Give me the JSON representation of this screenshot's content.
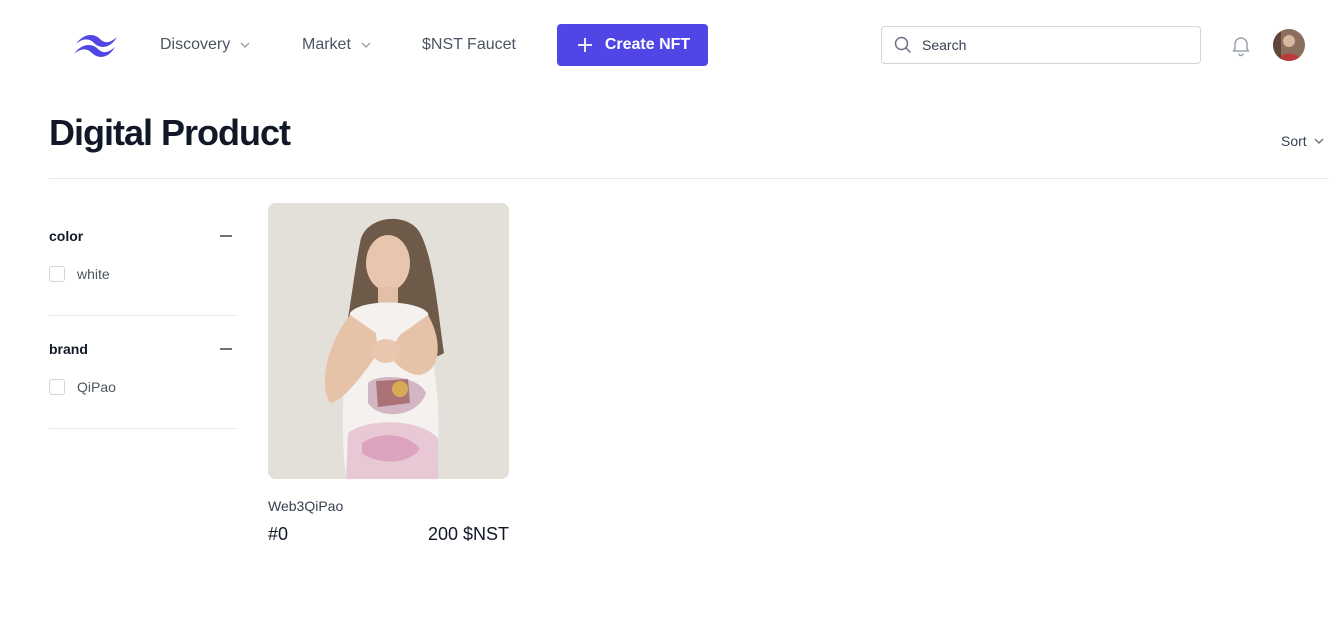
{
  "header": {
    "nav": [
      {
        "label": "Discovery",
        "has_dropdown": true
      },
      {
        "label": "Market",
        "has_dropdown": true
      },
      {
        "label": "$NST Faucet",
        "has_dropdown": false
      }
    ],
    "create_button": {
      "label": "Create NFT",
      "icon": "plus-icon"
    },
    "search": {
      "placeholder": "Search",
      "value": ""
    },
    "colors": {
      "accent": "#4f46e5"
    }
  },
  "page": {
    "title": "Digital Product",
    "sort_label": "Sort"
  },
  "filters": [
    {
      "title": "color",
      "options": [
        {
          "label": "white",
          "checked": false
        }
      ]
    },
    {
      "title": "brand",
      "options": [
        {
          "label": "QiPao",
          "checked": false
        }
      ]
    }
  ],
  "products": [
    {
      "name": "Web3QiPao",
      "id": "#0",
      "price": "200 $NST",
      "image": "woman-in-qipao-dress-photo"
    }
  ]
}
